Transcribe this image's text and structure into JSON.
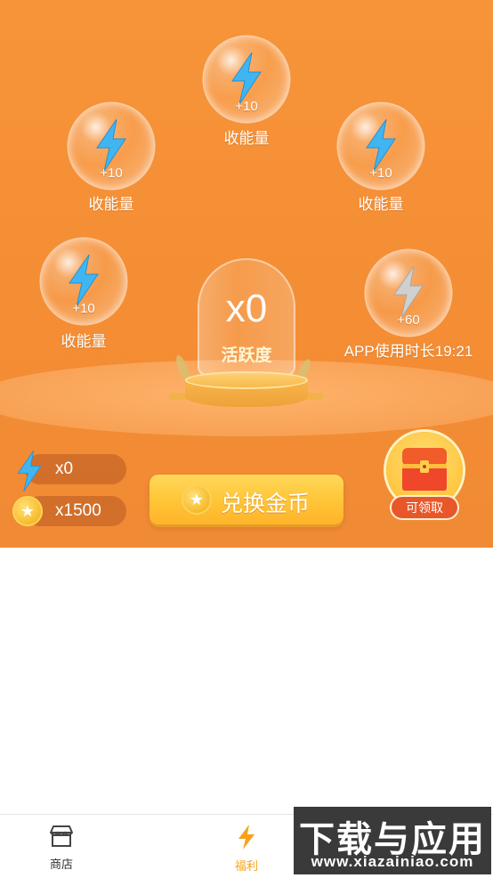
{
  "energy_bubbles": [
    {
      "amount": "+10",
      "label": "收能量",
      "color": "#3fb6f2"
    },
    {
      "amount": "+10",
      "label": "收能量",
      "color": "#3fb6f2"
    },
    {
      "amount": "+10",
      "label": "收能量",
      "color": "#3fb6f2"
    },
    {
      "amount": "+10",
      "label": "收能量",
      "color": "#3fb6f2"
    },
    {
      "amount": "+60",
      "label": "APP使用时长19:21",
      "color": "#d0d0d0"
    }
  ],
  "jar": {
    "count": "x0",
    "label": "活跃度"
  },
  "balances": {
    "energy": "x0",
    "coins": "x1500"
  },
  "exchange_button": {
    "label": "兑换金币"
  },
  "chest": {
    "badge": "可领取"
  },
  "tabbar": {
    "tabs": [
      {
        "label": "商店",
        "icon": "store-icon",
        "active": false
      },
      {
        "label": "福利",
        "icon": "lightning-icon",
        "active": true
      }
    ]
  },
  "watermark": {
    "top": "下载与应用",
    "bottom": "www.xiazainiao.com"
  },
  "colors": {
    "hero": "#f48d33",
    "accent": "#f7a21a",
    "badge": "#e8572a"
  }
}
